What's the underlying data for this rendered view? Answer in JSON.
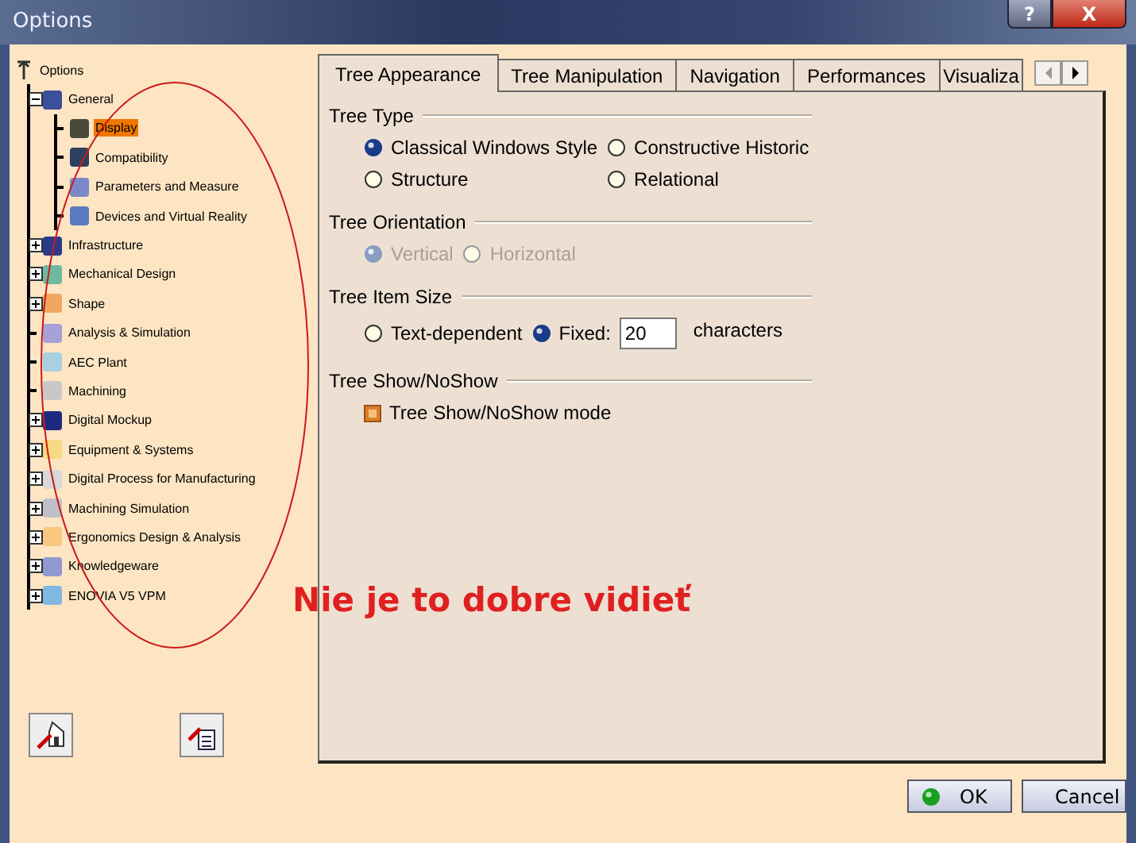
{
  "window": {
    "title": "Options",
    "help_button": "?",
    "close_button": "X"
  },
  "tree": {
    "label": "Options",
    "children": [
      {
        "label": "General",
        "expanded": true,
        "color": "#3c4f9a",
        "selected": false,
        "children": [
          {
            "label": "Display",
            "selected": true,
            "color": "#4a4a3a"
          },
          {
            "label": "Compatibility",
            "selected": false,
            "color": "#2f3f5f"
          },
          {
            "label": "Parameters and Measure",
            "selected": false,
            "color": "#7a8ac8"
          },
          {
            "label": "Devices and Virtual Reality",
            "selected": false,
            "color": "#5a7ac0"
          }
        ]
      },
      {
        "label": "Infrastructure",
        "expanded": false,
        "selected": false,
        "color": "#2d3a8c"
      },
      {
        "label": "Mechanical Design",
        "expanded": false,
        "selected": false,
        "color": "#6fb8a0"
      },
      {
        "label": "Shape",
        "expanded": false,
        "selected": false,
        "color": "#f0a860"
      },
      {
        "label": "Analysis & Simulation",
        "selected": false,
        "color": "#a8a0d8"
      },
      {
        "label": "AEC Plant",
        "selected": false,
        "color": "#a8d0e0"
      },
      {
        "label": "Machining",
        "selected": false,
        "color": "#c8c8c8"
      },
      {
        "label": "Digital Mockup",
        "expanded": false,
        "selected": false,
        "color": "#1e2a80"
      },
      {
        "label": "Equipment & Systems",
        "expanded": false,
        "selected": false,
        "color": "#f8d880"
      },
      {
        "label": "Digital Process for Manufacturing",
        "expanded": false,
        "selected": false,
        "color": "#d8d8d8"
      },
      {
        "label": "Machining Simulation",
        "expanded": false,
        "selected": false,
        "color": "#c0c0c8"
      },
      {
        "label": "Ergonomics Design & Analysis",
        "expanded": false,
        "selected": false,
        "color": "#f8c880"
      },
      {
        "label": "Knowledgeware",
        "expanded": false,
        "selected": false,
        "color": "#9098d0"
      },
      {
        "label": "ENOVIA V5 VPM",
        "expanded": false,
        "selected": false,
        "color": "#80b8e0"
      }
    ]
  },
  "tabs": [
    {
      "label": "Tree Appearance",
      "selected": true
    },
    {
      "label": "Tree Manipulation",
      "selected": false
    },
    {
      "label": "Navigation",
      "selected": false
    },
    {
      "label": "Performances",
      "selected": false
    },
    {
      "label": "Visualiza",
      "selected": false
    }
  ],
  "sections": [
    {
      "title": "Tree Type",
      "rows": [
        [
          {
            "kind": "radio",
            "label": "Classical Windows Style",
            "selected": true,
            "disabled": false
          },
          {
            "kind": "radio",
            "label": "Constructive Historic",
            "selected": false,
            "disabled": false
          }
        ],
        [
          {
            "kind": "radio",
            "label": "Structure",
            "selected": false,
            "disabled": false
          },
          {
            "kind": "radio",
            "label": "Relational",
            "selected": false,
            "disabled": false
          }
        ]
      ]
    },
    {
      "title": "Tree Orientation",
      "rows": [
        [
          {
            "kind": "radio",
            "label": "Vertical",
            "selected": true,
            "disabled": true
          },
          {
            "kind": "radio",
            "label": "Horizontal",
            "selected": false,
            "disabled": true
          }
        ]
      ]
    },
    {
      "title": "Tree Item Size",
      "rows": [
        [
          {
            "kind": "radio",
            "label": "Text-dependent",
            "selected": false,
            "disabled": false
          },
          {
            "kind": "radio",
            "label": "Fixed:",
            "selected": true,
            "disabled": false
          },
          {
            "kind": "field",
            "value": "20"
          },
          {
            "kind": "text",
            "label": "characters"
          }
        ]
      ]
    },
    {
      "title": "Tree Show/NoShow",
      "rows": [
        [
          {
            "kind": "checkbox",
            "label": "Tree Show/NoShow mode",
            "checked": true
          }
        ]
      ]
    }
  ],
  "buttons": [
    {
      "label": "OK",
      "kind": "ok"
    },
    {
      "label": "Cancel",
      "kind": "cancel"
    }
  ],
  "annotation": {
    "text": "Nie je to dobre vidieť"
  }
}
